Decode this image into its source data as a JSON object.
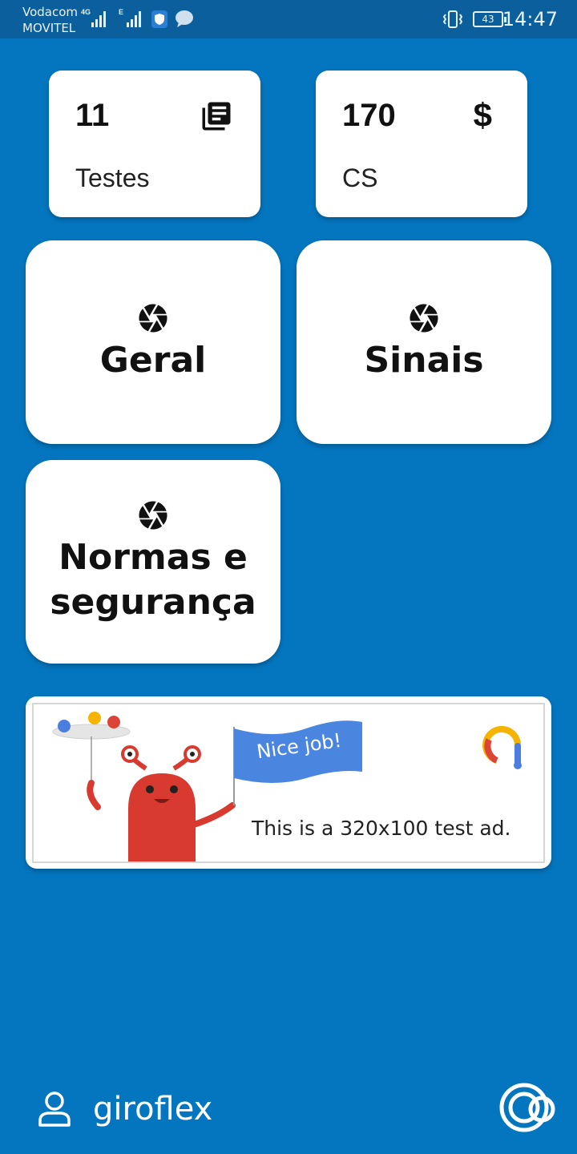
{
  "status_bar": {
    "carrier_1": "Vodacom",
    "carrier_2": "MOVITEL",
    "network_1": "4G",
    "network_2": "E",
    "battery": "43",
    "time": "14:47"
  },
  "stats": [
    {
      "value": "11",
      "label": "Testes",
      "icon": "newspaper-icon"
    },
    {
      "value": "170",
      "label": "CS",
      "icon": "$"
    }
  ],
  "categories": [
    {
      "title": "Geral",
      "icon": "aperture-icon"
    },
    {
      "title": "Sinais",
      "icon": "aperture-icon"
    },
    {
      "title": "Normas e segurança",
      "icon": "aperture-icon"
    }
  ],
  "ad": {
    "flag_text": "Nice job!",
    "body_text": "This is a 320x100 test ad."
  },
  "footer": {
    "username": "giroflex"
  },
  "colors": {
    "background": "#0476bf",
    "status_bar": "#0a5f9c",
    "card": "#ffffff",
    "flag": "#4a86e0",
    "monster": "#d83a2f"
  }
}
